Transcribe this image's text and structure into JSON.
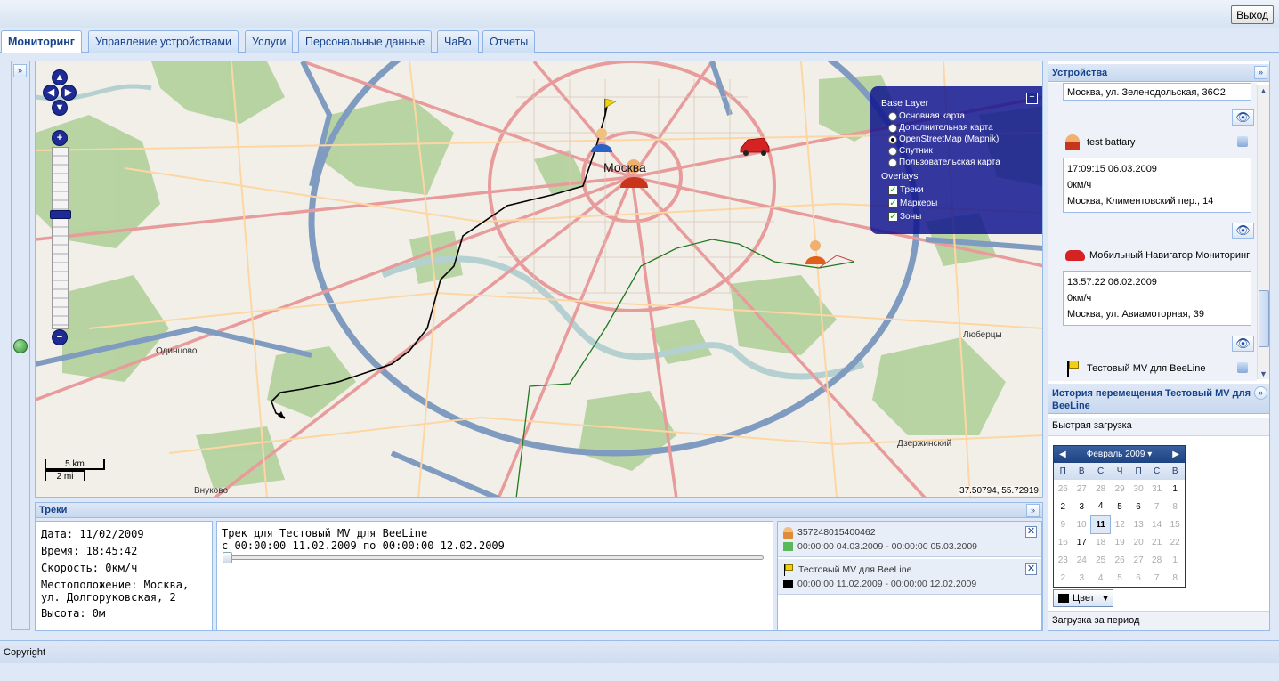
{
  "header": {
    "logout_label": "Выход"
  },
  "tabs": [
    {
      "label": "Мониторинг",
      "active": true
    },
    {
      "label": "Управление устройствами"
    },
    {
      "label": "Услуги"
    },
    {
      "label": "Персональные данные"
    },
    {
      "label": "ЧаВо"
    },
    {
      "label": "Отчеты"
    }
  ],
  "map": {
    "layers": {
      "base_title": "Base Layer",
      "base": [
        "Основная карта",
        "Дополнительная карта",
        "OpenStreetMap (Mapnik)",
        "Спутник",
        "Пользовательская карта"
      ],
      "base_selected": "OpenStreetMap (Mapnik)",
      "overlays_title": "Overlays",
      "overlays": [
        "Треки",
        "Маркеры",
        "Зоны"
      ]
    },
    "places": {
      "moscow": "Москва",
      "odintsovo": "Одинцово",
      "vnukovo": "Внуково",
      "lyubertsy": "Люберцы",
      "dzerzhinsky": "Дзержинский"
    },
    "scale": {
      "km": "5 km",
      "mi": "2 mi"
    },
    "coords": "37.50794, 55.72919",
    "colors": {
      "land": "#f2efe9",
      "forest": "#b5d29f",
      "water": "#b5d0d0",
      "major_road": "#e89b9b",
      "secondary_road": "#fdd6a4",
      "motorway": "#809bc0",
      "track_black": "#000000",
      "track_green": "#1f7a1f",
      "layerswitcher": "#0a0f8c"
    }
  },
  "tracks_panel": {
    "title": "Треки",
    "info": {
      "date": "Дата: 11/02/2009",
      "time": "Время: 18:45:42",
      "speed": "Скорость: 0км/ч",
      "location_line1": "Местоположение: Москва,",
      "location_line2": "ул. Долгоруковская, 2",
      "altitude": "Высота: 0м"
    },
    "track": {
      "title": "Трек для Тестовый MV для BeeLine",
      "range": "с 00:00:00 11.02.2009 по 00:00:00 12.02.2009",
      "progress": 0
    },
    "list": [
      {
        "name": "357248015400462",
        "period": "00:00:00 04.03.2009 - 00:00:00 05.03.2009",
        "color": "#5cb85c",
        "icon": "person-icon"
      },
      {
        "name": "Тестовый MV для BeeLine",
        "period": "00:00:00 11.02.2009 - 00:00:00 12.02.2009",
        "color": "#000000",
        "icon": "flag-icon"
      }
    ]
  },
  "devices_panel": {
    "title": "Устройства",
    "partial_address": "Москва, ул. Зеленодольская, 36С2",
    "devices": [
      {
        "name": "test battary",
        "time": "17:09:15 06.03.2009",
        "speed": "0км/ч",
        "address": "Москва, Климентовский пер., 14"
      },
      {
        "name": "Мобильный Навигатор Мониторинг",
        "time": "13:57:22 06.02.2009",
        "speed": "0км/ч",
        "address": "Москва, ул. Авиамоторная, 39"
      },
      {
        "name": "Тестовый MV для BeeLine"
      }
    ]
  },
  "history_panel": {
    "title": "История перемещения Тестовый MV для BeeLine",
    "quick_load": "Быстрая загрузка",
    "calendar": {
      "month": "Февраль 2009",
      "weekdays": [
        "П",
        "В",
        "С",
        "Ч",
        "П",
        "С",
        "В"
      ],
      "rows": [
        [
          "26",
          "27",
          "28",
          "29",
          "30",
          "31",
          "1"
        ],
        [
          "2",
          "3",
          "4",
          "5",
          "6",
          "7",
          "8"
        ],
        [
          "9",
          "10",
          "11",
          "12",
          "13",
          "14",
          "15"
        ],
        [
          "16",
          "17",
          "18",
          "19",
          "20",
          "21",
          "22"
        ],
        [
          "23",
          "24",
          "25",
          "26",
          "27",
          "28",
          "1"
        ],
        [
          "2",
          "3",
          "4",
          "5",
          "6",
          "7",
          "8"
        ]
      ],
      "selected": "11"
    },
    "color_button": "Цвет",
    "period_load": "Загрузка за период"
  },
  "footer": {
    "copyright": "Copyright"
  }
}
